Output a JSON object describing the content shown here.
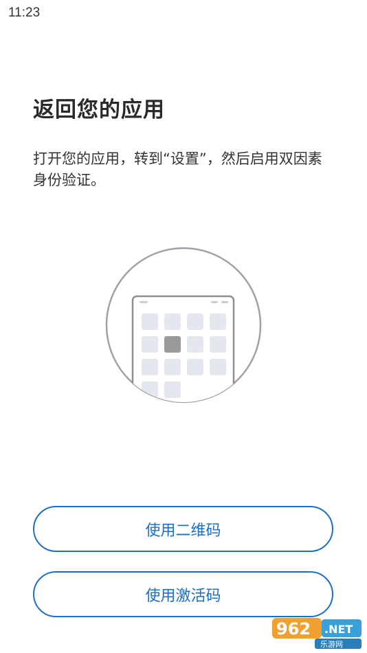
{
  "status_bar": {
    "time": "11:23"
  },
  "main": {
    "title": "返回您的应用",
    "description": "打开您的应用，转到“设置”，然后启用双因素身份验证。"
  },
  "illustration": {
    "icon": "phone-app-grid-illustration",
    "highlight_color": "#9a9a9a",
    "tile_color": "#e4e8ee",
    "outline_color": "#9da3a8"
  },
  "actions": {
    "qr_button_label": "使用二维码",
    "activation_button_label": "使用激活码",
    "accent_color": "#1a6fc4"
  },
  "watermark": {
    "brand": "962.NET",
    "subtitle": "乐游网"
  }
}
